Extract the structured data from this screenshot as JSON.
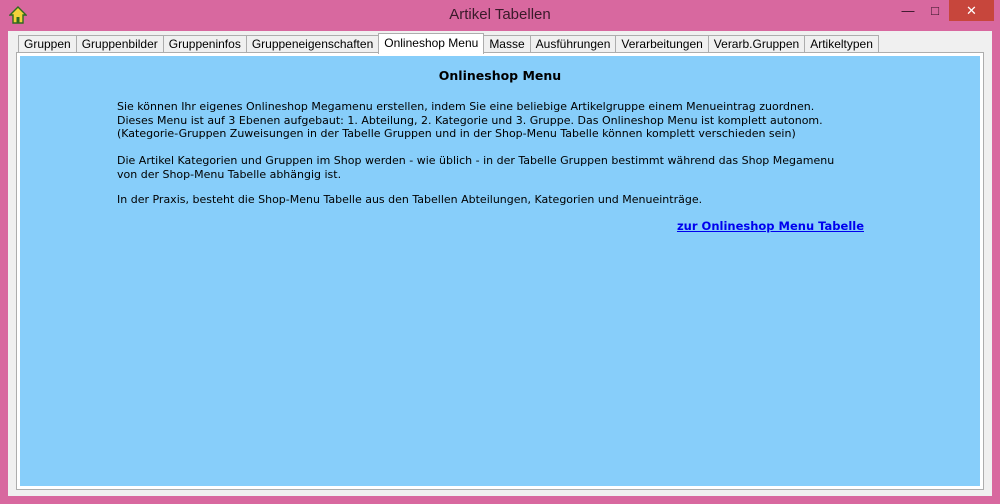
{
  "window": {
    "title": "Artikel Tabellen",
    "minimize_glyph": "—",
    "maximize_glyph": "□",
    "close_glyph": "✕"
  },
  "tabs": [
    {
      "label": "Gruppen",
      "active": false
    },
    {
      "label": "Gruppenbilder",
      "active": false
    },
    {
      "label": "Gruppeninfos",
      "active": false
    },
    {
      "label": "Gruppeneigenschaften",
      "active": false
    },
    {
      "label": "Onlineshop Menu",
      "active": true
    },
    {
      "label": "Masse",
      "active": false
    },
    {
      "label": "Ausführungen",
      "active": false
    },
    {
      "label": "Verarbeitungen",
      "active": false
    },
    {
      "label": "Verarb.Gruppen",
      "active": false
    },
    {
      "label": "Artikeltypen",
      "active": false
    }
  ],
  "content": {
    "heading": "Onlineshop Menu",
    "paragraph1": {
      "line1": "Sie können Ihr eigenes Onlineshop Megamenu erstellen, indem Sie eine beliebige Artikelgruppe einem Menueintrag zuordnen.",
      "line2": "Dieses Menu ist auf 3 Ebenen aufgebaut: 1. Abteilung, 2. Kategorie und 3. Gruppe. Das Onlineshop Menu ist komplett autonom.",
      "line3": "(Kategorie-Gruppen Zuweisungen in der Tabelle Gruppen und in der Shop-Menu Tabelle können komplett verschieden sein)"
    },
    "paragraph2": {
      "line1": "Die Artikel Kategorien und Gruppen im Shop werden - wie üblich - in der Tabelle Gruppen bestimmt während das Shop Megamenu",
      "line2": "von der Shop-Menu Tabelle abhängig ist."
    },
    "paragraph3": "In der Praxis, besteht die Shop-Menu Tabelle aus den Tabellen Abteilungen, Kategorien und Menueinträge.",
    "link_text": "zur Onlineshop Menu Tabelle"
  },
  "colors": {
    "window_frame": "#d8689f",
    "content_background": "#87cefa",
    "link": "#0000ee",
    "close_button": "#c7463c"
  },
  "icons": {
    "app": "house-icon"
  }
}
